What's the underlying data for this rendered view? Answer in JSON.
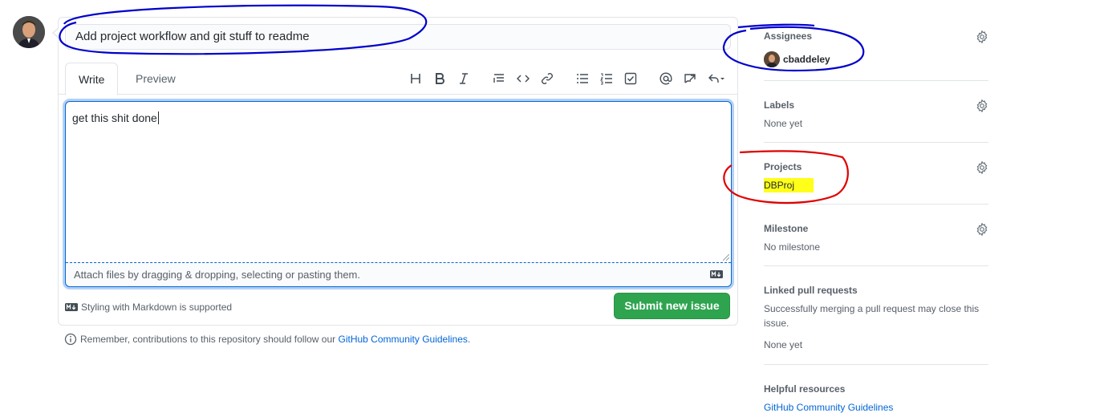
{
  "issue": {
    "title": "Add project workflow and git stuff to readme",
    "tabs": [
      {
        "label": "Write"
      },
      {
        "label": "Preview"
      }
    ],
    "body_text": "get this shit done",
    "attach_hint": "Attach files by dragging & dropping, selecting or pasting them.",
    "markdown_note": "Styling with Markdown is supported",
    "submit_label": "Submit new issue"
  },
  "reminder": {
    "text": "Remember, contributions to this repository should follow our",
    "link": "GitHub Community Guidelines",
    "suffix": "."
  },
  "sidebar": {
    "assignees": {
      "heading": "Assignees",
      "user": "cbaddeley"
    },
    "labels": {
      "heading": "Labels",
      "value": "None yet"
    },
    "projects": {
      "heading": "Projects",
      "value": "DBProj"
    },
    "milestone": {
      "heading": "Milestone",
      "value": "No milestone"
    },
    "linked_prs": {
      "heading": "Linked pull requests",
      "description": "Successfully merging a pull request may close this issue.",
      "value": "None yet"
    },
    "helpful": {
      "heading": "Helpful resources",
      "link": "GitHub Community Guidelines"
    }
  },
  "colors": {
    "accent_blue": "#0366d6",
    "submit_green": "#2ea44f",
    "annotation_blue": "#0000cc",
    "annotation_red": "#e00000",
    "highlight_yellow": "#ffff1a"
  }
}
